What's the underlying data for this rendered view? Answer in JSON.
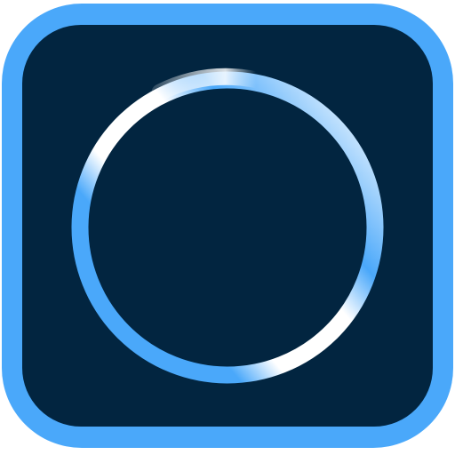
{
  "icon": {
    "name": "ring-app-icon",
    "colors": {
      "frame": "#4aa8fa",
      "background": "#022540",
      "ring_blue": "#4aa8fa",
      "ring_highlight": "#ffffff"
    }
  }
}
